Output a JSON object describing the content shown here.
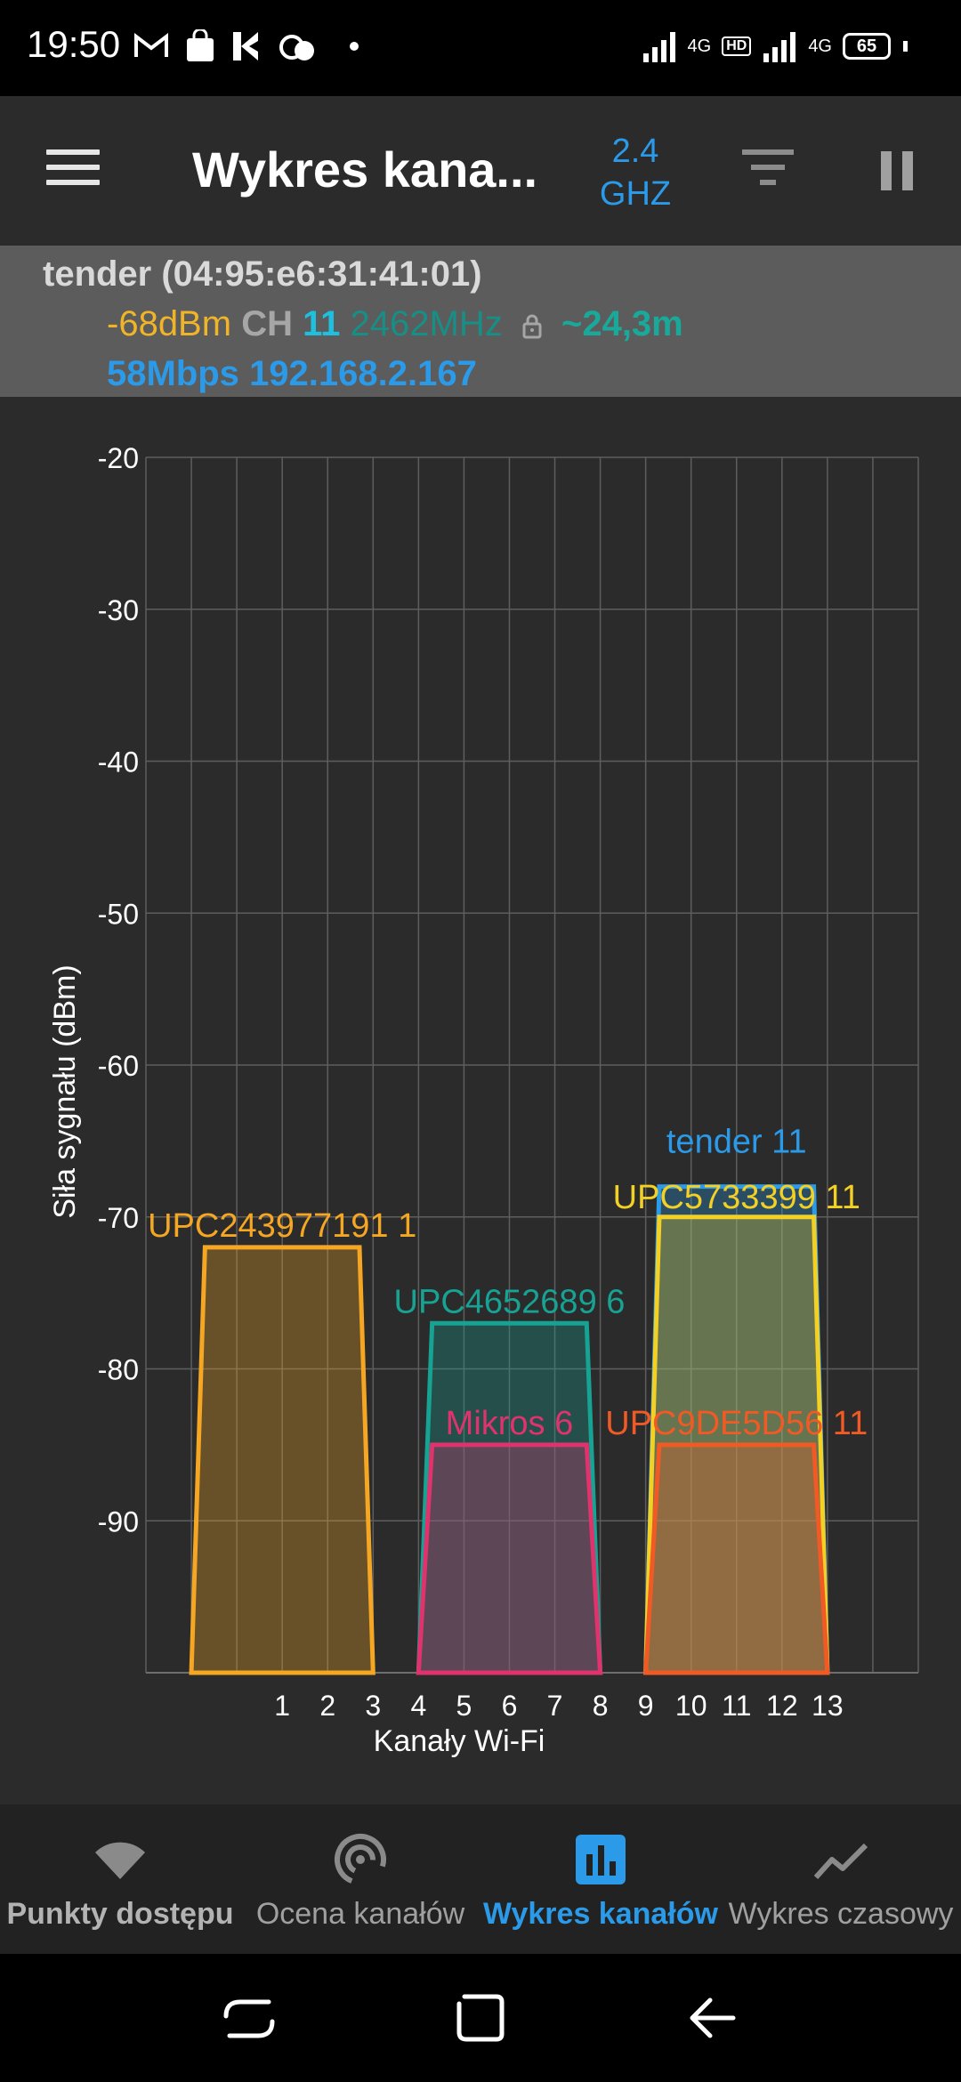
{
  "status_bar": {
    "time": "19:50",
    "left_icons": [
      "gmail-icon",
      "shopping-bag-icon",
      "app-k-icon",
      "weather-icon",
      "dot-icon"
    ],
    "network_label_1": "4G",
    "hd_label": "HD",
    "network_label_2": "4G",
    "battery": "65"
  },
  "app_bar": {
    "title": "Wykres kana...",
    "band_line1": "2.4",
    "band_line2": "GHZ"
  },
  "connection": {
    "ssid_line": "tender (04:95:e6:31:41:01)",
    "signal": "-68dBm",
    "ch_label": "CH",
    "channel": "11",
    "frequency": "2462MHz",
    "distance": "~24,3m",
    "speed": "58Mbps",
    "ip": "192.168.2.167"
  },
  "chart_data": {
    "type": "area",
    "ylabel": "Siła sygnału (dBm)",
    "xlabel": "Kanały Wi-Fi",
    "y_ticks": [
      "-20",
      "-30",
      "-40",
      "-50",
      "-60",
      "-70",
      "-80",
      "-90"
    ],
    "x_ticks": [
      "1",
      "2",
      "3",
      "4",
      "5",
      "6",
      "7",
      "8",
      "9",
      "10",
      "11",
      "12",
      "13"
    ],
    "ylim": [
      -100,
      -20
    ],
    "x_domain": [
      -2,
      15
    ],
    "grid": true,
    "series": [
      {
        "name": "UPC243977191 1",
        "channel": 1,
        "x_start": -1,
        "x_end": 3,
        "level": -72,
        "color": "#f5a623"
      },
      {
        "name": "UPC4652689 6",
        "channel": 6,
        "x_start": 4,
        "x_end": 8,
        "level": -77,
        "color": "#16a394"
      },
      {
        "name": "Mikros 6",
        "channel": 6,
        "x_start": 4,
        "x_end": 8,
        "level": -85,
        "color": "#e0336e"
      },
      {
        "name": "tender 11",
        "channel": 11,
        "x_start": 9,
        "x_end": 13,
        "level": -68,
        "color": "#2b9ae8"
      },
      {
        "name": "UPC5733399 11",
        "channel": 11,
        "x_start": 9,
        "x_end": 13,
        "level": -70,
        "color": "#f2d024"
      },
      {
        "name": "UPC9DE5D56 11",
        "channel": 11,
        "x_start": 9,
        "x_end": 13,
        "level": -85,
        "color": "#f15a24"
      }
    ]
  },
  "bottom_nav": {
    "items": [
      {
        "label": "Punkty dostępu",
        "icon": "wifi-icon",
        "active": false
      },
      {
        "label": "Ocena kanałów",
        "icon": "signal-rating-icon",
        "active": false
      },
      {
        "label": "Wykres kanałów",
        "icon": "bar-chart-icon",
        "active": true
      },
      {
        "label": "Wykres czasowy",
        "icon": "line-chart-icon",
        "active": false
      }
    ]
  },
  "colors": {
    "accent": "#2b9ae8",
    "app_bar_bg": "#2b2b2b",
    "info_bg": "#5c5c5c"
  }
}
